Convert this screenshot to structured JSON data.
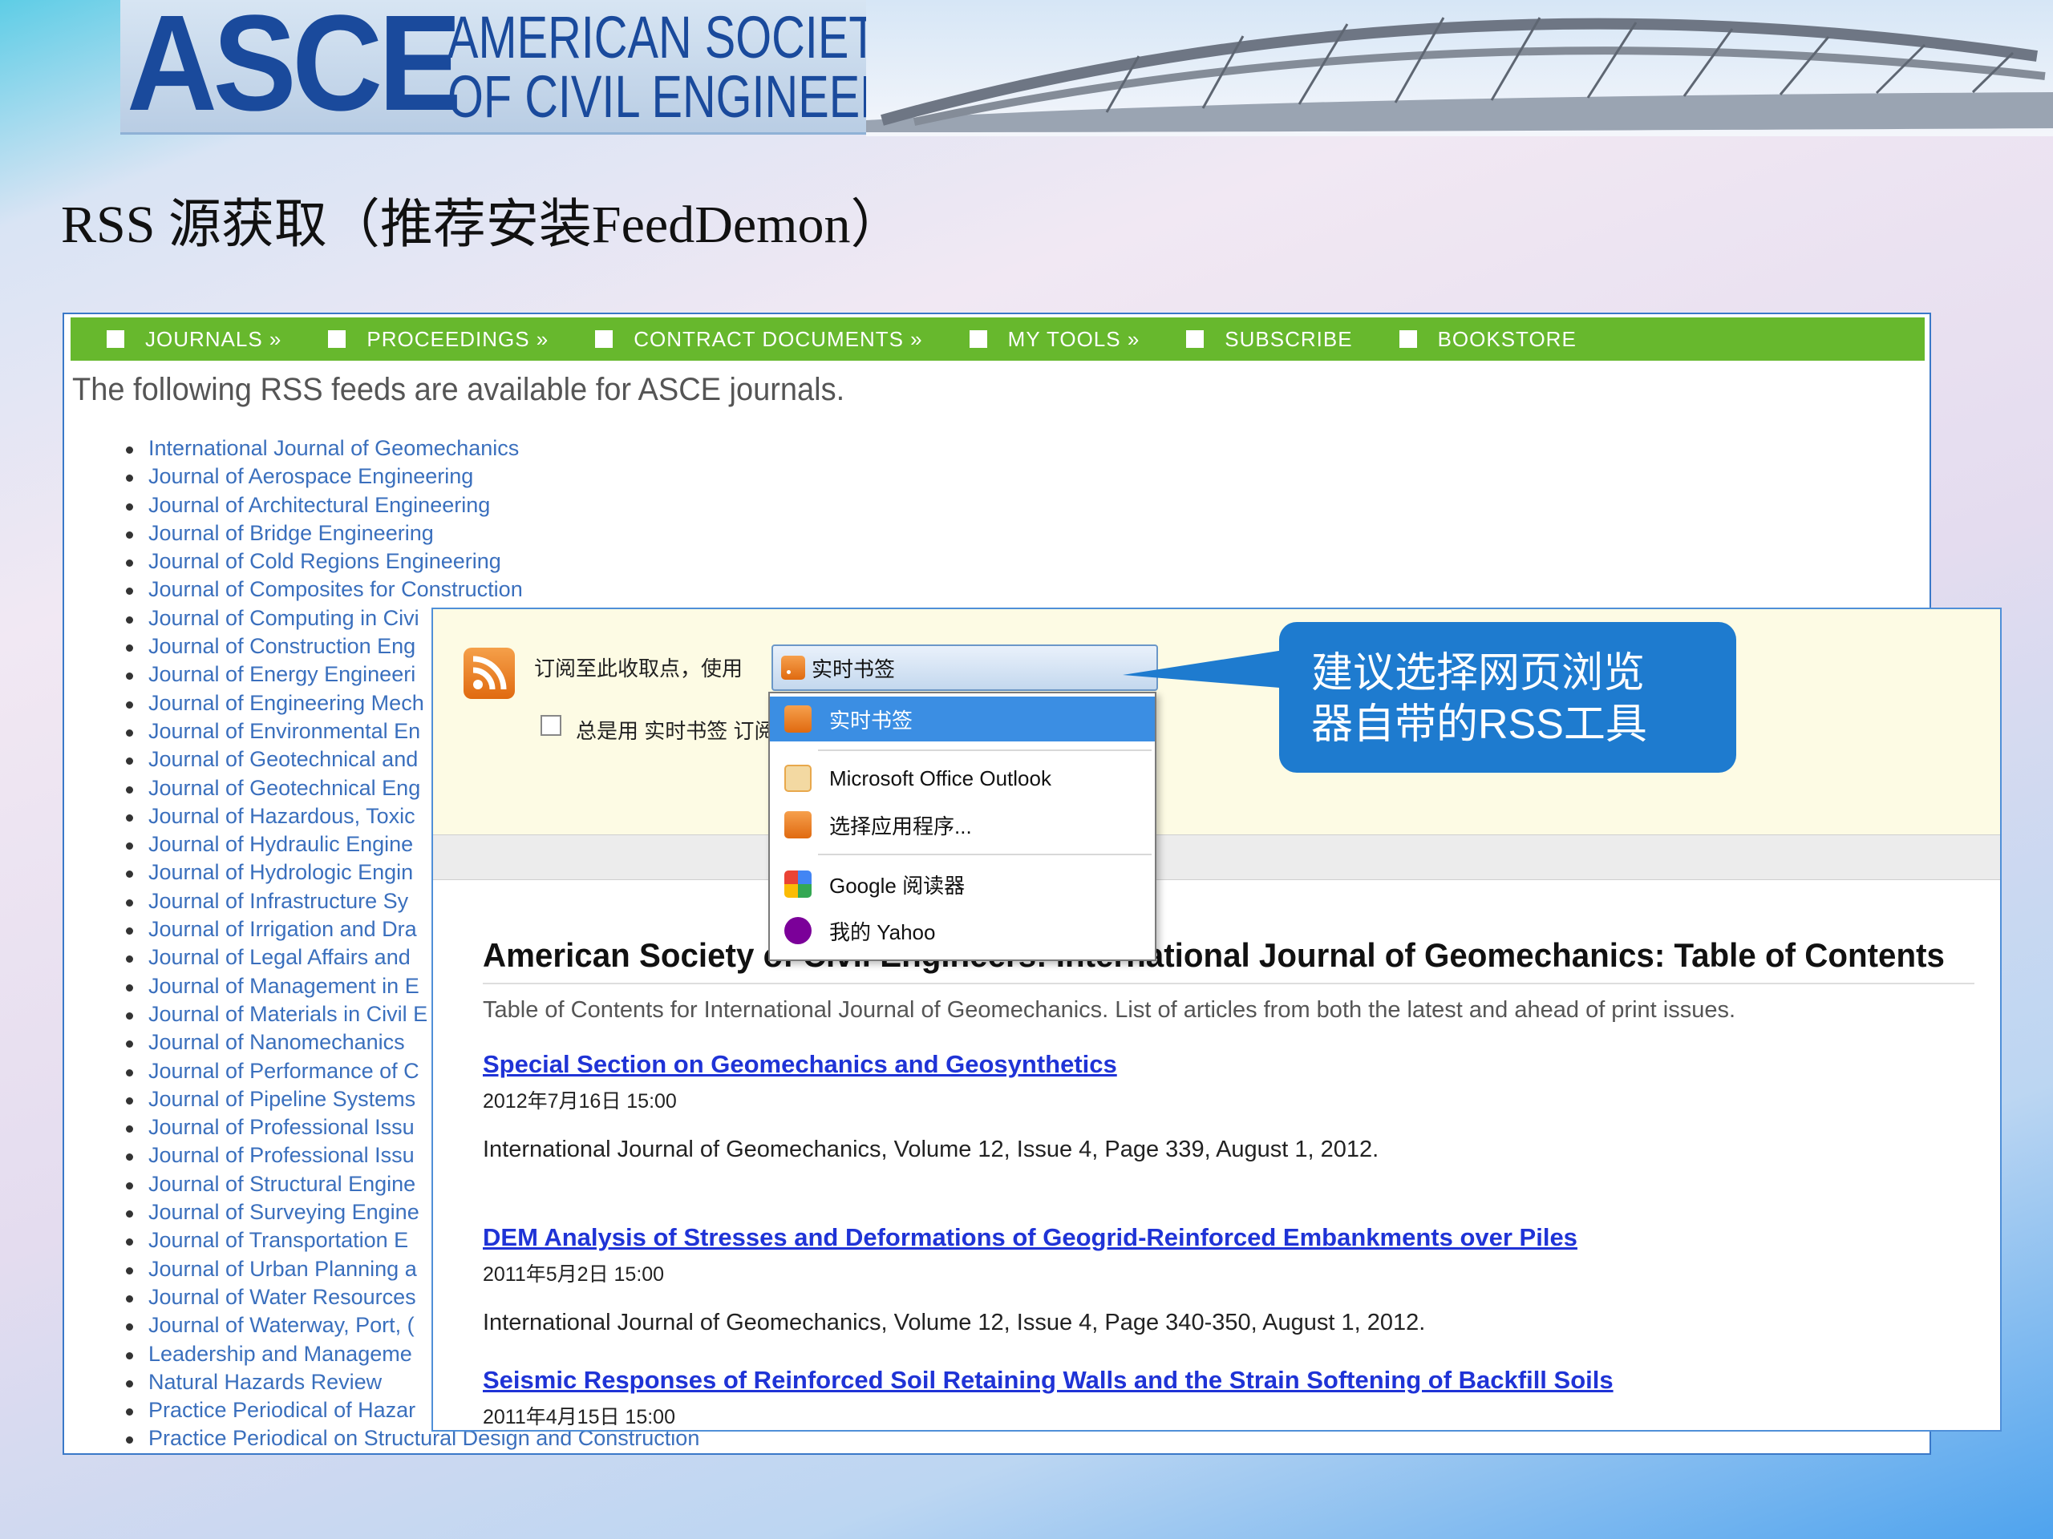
{
  "logo": {
    "mark": "ASCE",
    "line1": "AMERICAN SOCIETY",
    "line2": "OF CIVIL ENGINEERS"
  },
  "slide_title": "RSS 源获取（推荐安装FeedDemon）",
  "nav": [
    {
      "label": "JOURNALS »"
    },
    {
      "label": "PROCEEDINGS »"
    },
    {
      "label": "CONTRACT DOCUMENTS »"
    },
    {
      "label": "MY TOOLS »"
    },
    {
      "label": "SUBSCRIBE"
    },
    {
      "label": "BOOKSTORE"
    }
  ],
  "intro": "The following RSS feeds are available for ASCE journals.",
  "journals": [
    "International Journal of Geomechanics",
    "Journal of Aerospace Engineering",
    "Journal of Architectural Engineering",
    "Journal of Bridge Engineering",
    "Journal of Cold Regions Engineering",
    "Journal of Composites for Construction",
    "Journal of Computing in Civi",
    "Journal of Construction Eng",
    "Journal of Energy Engineeri",
    "Journal of Engineering Mech",
    "Journal of Environmental En",
    "Journal of Geotechnical and",
    "Journal of Geotechnical Eng",
    "Journal of Hazardous, Toxic",
    "Journal of Hydraulic Engine",
    "Journal of Hydrologic Engin",
    "Journal of Infrastructure Sy",
    "Journal of Irrigation and Dra",
    "Journal of Legal Affairs and",
    "Journal of Management in E",
    "Journal of Materials in Civil E",
    "Journal of Nanomechanics",
    "Journal of Performance of C",
    "Journal of Pipeline Systems",
    "Journal of Professional Issu",
    "Journal of Professional Issu",
    "Journal of Structural Engine",
    "Journal of Surveying Engine",
    "Journal of Transportation E",
    "Journal of Urban Planning a",
    "Journal of Water Resources",
    "Journal of Waterway, Port, (",
    "Leadership and Manageme",
    "Natural Hazards Review",
    "Practice Periodical of Hazar",
    "Practice Periodical on Structural Design and Construction"
  ],
  "subscribe": {
    "label": "订阅至此收取点，使用",
    "selected": "实时书签",
    "always_label": "总是用 实时书签 订阅"
  },
  "dropdown": {
    "items": [
      {
        "label": "实时书签",
        "icon": "rss-icon"
      },
      {
        "label": "Microsoft Office Outlook",
        "icon": "outlook-icon"
      },
      {
        "label": "选择应用程序...",
        "icon": "rss-icon"
      },
      {
        "label": "Google 阅读器",
        "icon": "google-icon"
      },
      {
        "label": "我的 Yahoo",
        "icon": "yahoo-icon"
      }
    ]
  },
  "feed": {
    "title": "American Society of Civil Engineers: International Journal of Geomechanics: Table of Contents",
    "description": "Table of Contents for International Journal of Geomechanics. List of articles from both the latest and ahead of print issues.",
    "articles": [
      {
        "title": "Special Section on Geomechanics and Geosynthetics",
        "date": "2012年7月16日 15:00",
        "cite": "International Journal of Geomechanics, Volume 12, Issue 4, Page 339, August 1, 2012."
      },
      {
        "title": "DEM Analysis of Stresses and Deformations of Geogrid-Reinforced Embankments over Piles",
        "date": "2011年5月2日 15:00",
        "cite": "International Journal of Geomechanics, Volume 12, Issue 4, Page 340-350, August 1, 2012."
      },
      {
        "title": "Seismic Responses of Reinforced Soil Retaining Walls and the Strain Softening of Backfill Soils",
        "date": "2011年4月15日 15:00",
        "cite": ""
      }
    ]
  },
  "callout": {
    "line1": "建议选择网页浏览",
    "line2": "器自带的RSS工具"
  },
  "colors": {
    "nav_green": "#67b82d",
    "link_blue": "#3a6fbd",
    "article_blue": "#1f33d6",
    "callout_blue": "#1e7bcf",
    "rss_orange": "#e8801f"
  }
}
